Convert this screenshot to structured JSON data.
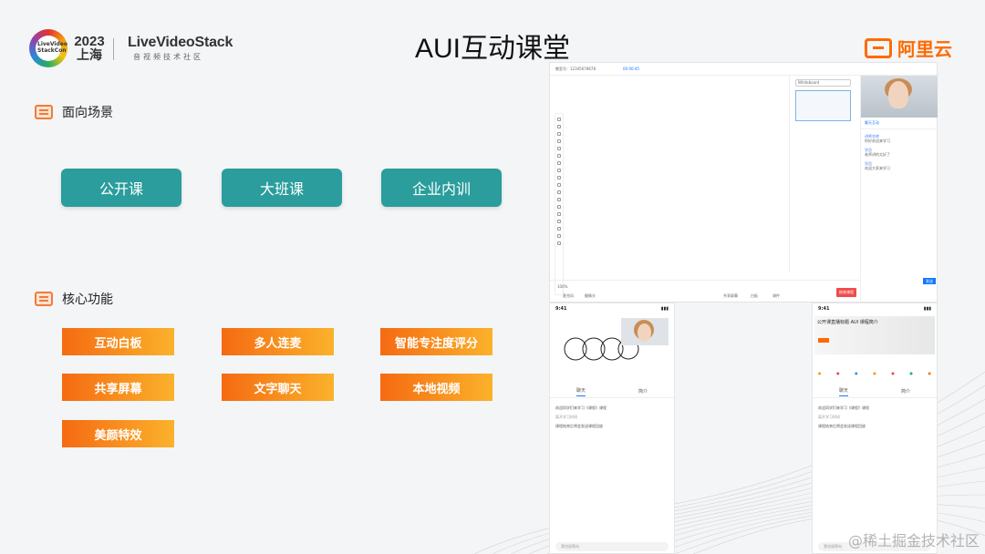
{
  "header": {
    "conf_logo_text": "LiveVideo StackCon",
    "year": "2023",
    "city": "上海",
    "org_name": "LiveVideoStack",
    "org_sub": "音视频技术社区",
    "title": "AUI互动课堂",
    "brand": "阿里云"
  },
  "scenarios": {
    "heading": "面向场景",
    "items": [
      "公开课",
      "大班课",
      "企业内训"
    ]
  },
  "features": {
    "heading": "核心功能",
    "items": [
      "互动白板",
      "多人连麦",
      "智能专注度评分",
      "共享屏幕",
      "文字聊天",
      "本地视频",
      "美颜特效"
    ]
  },
  "desktop": {
    "class_id": "教室号：12345678678",
    "timer": "00:00:45",
    "whiteboard_select": "Whiteboard",
    "chat_tab": "聊天互动",
    "messages": [
      {
        "name": "讲师名称",
        "text": "你好欢迎来学习"
      },
      {
        "name": "学员",
        "text": "老师讲的太好了"
      },
      {
        "name": "学员",
        "text": "欢迎大家来学习"
      }
    ],
    "send_label": "发送",
    "end_label": "结束课程",
    "zoom": "100%",
    "bottom_tools": [
      "麦克风",
      "摄像头",
      "共享屏幕",
      "白板",
      "课件"
    ]
  },
  "phone_left": {
    "time": "9:41",
    "tab_chat": "聊天",
    "tab_intro": "简介",
    "messages": [
      "欢迎同学们来学习《课程》课程",
      "离开学习时间",
      "课程结束后将会发送课程回放"
    ],
    "input_placeholder": "我也说两句"
  },
  "phone_right": {
    "time": "9:41",
    "banner_title": "公开课直播标题 AUI 课程简介",
    "tab_chat": "聊天",
    "tab_intro": "简介",
    "messages": [
      "欢迎同学们来学习《课程》课程",
      "离开学习时间",
      "课程结束后将会发送课程回放"
    ],
    "input_placeholder": "我也说两句"
  },
  "watermark": "@稀土掘金技术社区",
  "colors": {
    "teal": "#2a9d9c",
    "orange_start": "#f56a12",
    "orange_end": "#fbb22b",
    "brand_orange": "#ff6a00"
  }
}
